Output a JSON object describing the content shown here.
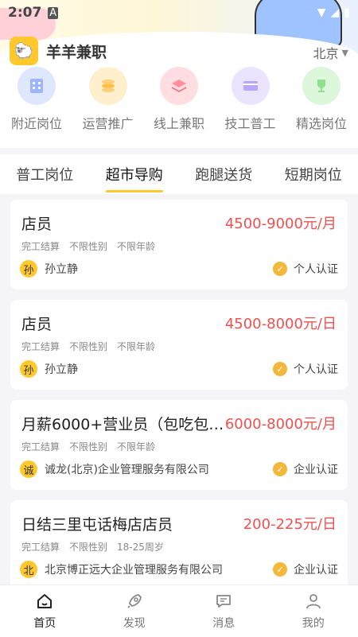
{
  "status_bar": {
    "time": "2:07",
    "icons": [
      "notification-icon",
      "wifi-icon",
      "signal-icon",
      "battery-icon"
    ]
  },
  "app": {
    "title": "羊羊兼职",
    "city": "北京"
  },
  "categories": [
    {
      "label": "附近岗位",
      "icon": "building-icon",
      "color": "#9db4ff"
    },
    {
      "label": "运营推广",
      "icon": "coins-icon",
      "color": "#ffcf7a"
    },
    {
      "label": "线上兼职",
      "icon": "layers-icon",
      "color": "#ff8f9c"
    },
    {
      "label": "技工普工",
      "icon": "card-icon",
      "color": "#b9a6ff"
    },
    {
      "label": "精选岗位",
      "icon": "trophy-icon",
      "color": "#8fe08f"
    }
  ],
  "tabs": [
    {
      "label": "普工岗位",
      "active": false
    },
    {
      "label": "超市导购",
      "active": true
    },
    {
      "label": "跑腿送货",
      "active": false
    },
    {
      "label": "短期岗位",
      "active": false
    }
  ],
  "jobs": [
    {
      "title": "店员",
      "salary": "4500-9000元/月",
      "tags": [
        "完工结算",
        "不限性别",
        "不限年龄"
      ],
      "avatar": "孙",
      "poster": "孙立静",
      "verify": "个人认证"
    },
    {
      "title": "店员",
      "salary": "4500-8000元/日",
      "tags": [
        "完工结算",
        "不限性别",
        "不限年龄"
      ],
      "avatar": "孙",
      "poster": "孙立静",
      "verify": "个人认证"
    },
    {
      "title": "月薪6000+营业员（包吃包住...",
      "salary": "6000-8000元/月",
      "tags": [
        "完工结算",
        "不限性别",
        "不限年龄"
      ],
      "avatar": "诚",
      "poster": "诚龙(北京)企业管理服务有限公司",
      "verify": "企业认证"
    },
    {
      "title": "日结三里屯话梅店店员",
      "salary": "200-225元/日",
      "tags": [
        "完工结算",
        "不限性别",
        "18-25周岁"
      ],
      "avatar": "北",
      "poster": "北京博正远大企业管理服务有限公司",
      "verify": "企业认证"
    }
  ],
  "bottom_nav": [
    {
      "label": "首页",
      "icon": "home-icon",
      "active": true
    },
    {
      "label": "发现",
      "icon": "rocket-icon",
      "active": false
    },
    {
      "label": "消息",
      "icon": "message-icon",
      "active": false
    },
    {
      "label": "我的",
      "icon": "user-icon",
      "active": false
    }
  ],
  "colors": {
    "accent": "#ffc82c",
    "salary": "#f05050"
  }
}
